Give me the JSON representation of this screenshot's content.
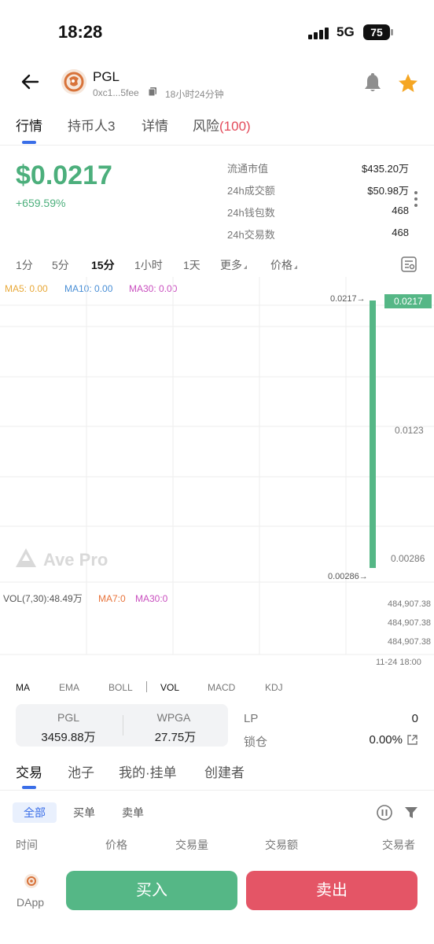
{
  "status": {
    "time": "18:28",
    "network": "5G",
    "battery": "75"
  },
  "header": {
    "name": "PGL",
    "address": "0xc1...5fee",
    "age": "18小时24分钟"
  },
  "tabs": [
    {
      "label": "行情"
    },
    {
      "label": "持币人3"
    },
    {
      "label": "详情"
    },
    {
      "label": "风险",
      "badge": "(100)"
    }
  ],
  "price": {
    "value": "$0.0217",
    "change": "+659.59%"
  },
  "stats": [
    {
      "label": "流通市值",
      "value": "$435.20万"
    },
    {
      "label": "24h成交额",
      "value": "$50.98万"
    },
    {
      "label": "24h钱包数",
      "value": "468"
    },
    {
      "label": "24h交易数",
      "value": "468"
    }
  ],
  "intervals": [
    "1分",
    "5分",
    "15分",
    "1小时",
    "1天",
    "更多",
    "价格"
  ],
  "active_interval": "15分",
  "ma": {
    "ma5": "MA5: 0.00",
    "ma10": "MA10: 0.00",
    "ma30": "MA30: 0.00"
  },
  "chart_data": {
    "type": "candlestick",
    "price_axis_labels": [
      "0.0217",
      "0.0123",
      "0.00286"
    ],
    "candle": {
      "open": 0.00286,
      "high": 0.0217,
      "low": 0.00286,
      "close": 0.0217
    },
    "high_marker": "0.0217→",
    "low_marker": "0.00286→",
    "current_price_tag": "0.0217",
    "watermark": "Ave Pro",
    "volume": {
      "summary": "VOL(7,30):48.49万",
      "ma7": "MA7:0",
      "ma30": "MA30:0",
      "axis_labels": [
        "484,907.38",
        "484,907.38",
        "484,907.38"
      ]
    },
    "time_label": "11-24 18:00",
    "colors": {
      "up": "#55b786",
      "grid": "#eeeeee"
    }
  },
  "indicators": [
    "MA",
    "EMA",
    "BOLL",
    "VOL",
    "MACD",
    "KDJ"
  ],
  "pool": {
    "token_a": {
      "name": "PGL",
      "amount": "3459.88万"
    },
    "token_b": {
      "name": "WPGA",
      "amount": "27.75万"
    },
    "lp_label": "LP",
    "lp_value": "0",
    "lock_label": "锁仓",
    "lock_value": "0.00%"
  },
  "trade_tabs": [
    "交易",
    "池子",
    "我的·挂单",
    "创建者"
  ],
  "filters": [
    "全部",
    "买单",
    "卖单"
  ],
  "table_headers": [
    "时间",
    "价格",
    "交易量",
    "交易额",
    "交易者"
  ],
  "bottom": {
    "dapp": "DApp",
    "buy": "买入",
    "sell": "卖出"
  },
  "colors": {
    "accent": "#3a6ee8",
    "up": "#4caf7c",
    "down": "#e45566",
    "star": "#f5a623"
  }
}
